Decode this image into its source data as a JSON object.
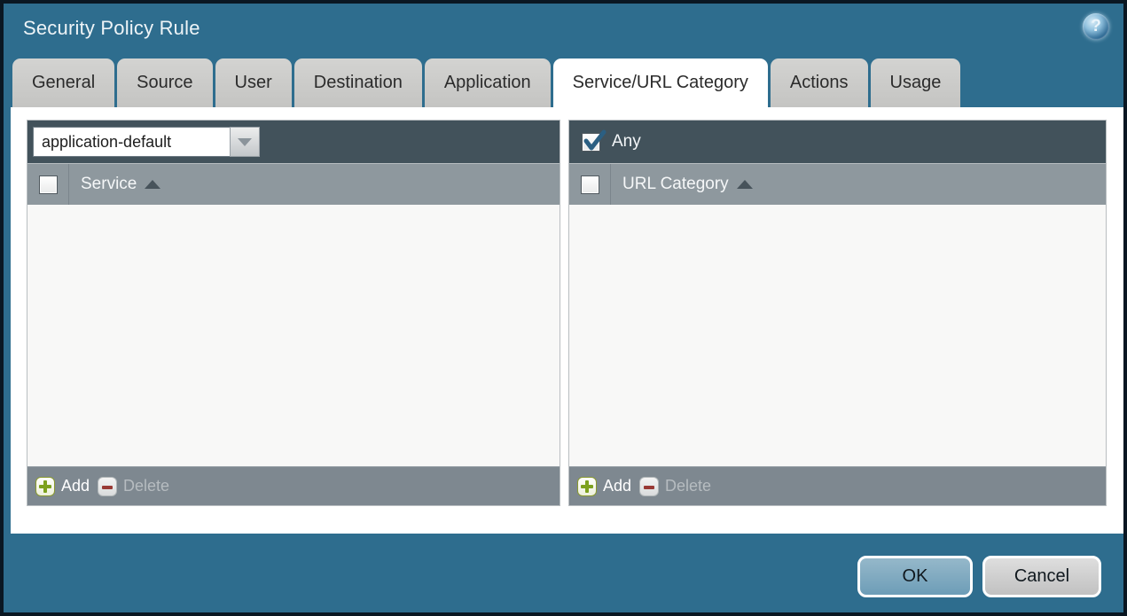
{
  "window": {
    "title": "Security Policy Rule",
    "help_icon": "?"
  },
  "tabs": [
    {
      "label": "General",
      "active": false
    },
    {
      "label": "Source",
      "active": false
    },
    {
      "label": "User",
      "active": false
    },
    {
      "label": "Destination",
      "active": false
    },
    {
      "label": "Application",
      "active": false
    },
    {
      "label": "Service/URL Category",
      "active": true
    },
    {
      "label": "Actions",
      "active": false
    },
    {
      "label": "Usage",
      "active": false
    }
  ],
  "service_panel": {
    "dropdown_value": "application-default",
    "column_header": "Service",
    "column_sorted": "ascending",
    "rows": [],
    "select_all_checked": false,
    "add_label": "Add",
    "delete_label": "Delete",
    "delete_enabled": false
  },
  "url_category_panel": {
    "any_label": "Any",
    "any_checked": true,
    "column_header": "URL Category",
    "column_sorted": "ascending",
    "rows": [],
    "select_all_checked": false,
    "add_label": "Add",
    "delete_label": "Delete",
    "delete_enabled": false
  },
  "dialog_buttons": {
    "ok": "OK",
    "cancel": "Cancel"
  },
  "colors": {
    "window_teal": "#2e6d8e",
    "window_border": "#0a1722",
    "panel_header_dark": "#42525b",
    "column_header_gray": "#8e989e",
    "footer_gray": "#7e8890",
    "list_background": "#f8f8f7",
    "tab_inactive": "#c9c9c7",
    "tab_active": "#ffffff",
    "ok_button": "#7ba8c0",
    "cancel_button": "#c9c9c9",
    "add_icon_green": "#7da11e",
    "delete_icon_red": "#993a35",
    "check_blue": "#2b5f82"
  }
}
